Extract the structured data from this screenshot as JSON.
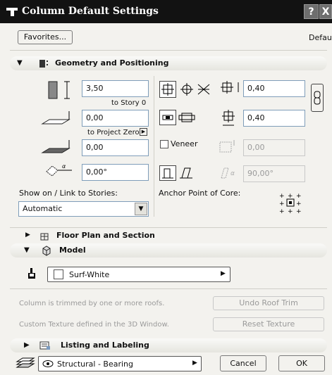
{
  "window": {
    "title": "Column Default Settings",
    "help": "?",
    "close": "X"
  },
  "toolbar": {
    "favorites": "Favorites...",
    "default": "Default"
  },
  "geometry": {
    "header": "Geometry and Positioning",
    "height_value": "3,50",
    "height_ref": "to Story 0",
    "bottom_value": "0,00",
    "bottom_ref": "to Project Zero",
    "offset_value": "0,00",
    "angle_value": "0,00°",
    "show_on_label": "Show on / Link to Stories:",
    "show_on_value": "Automatic",
    "width_value": "0,40",
    "depth_value": "0,40",
    "veneer_label": "Veneer",
    "veneer_value": "0,00",
    "slant_value": "90,00°",
    "anchor_label": "Anchor Point of Core:"
  },
  "floor_plan": {
    "header": "Floor Plan and Section"
  },
  "model": {
    "header": "Model",
    "surface": "Surf-White",
    "roof_msg": "Column is trimmed by one or more roofs.",
    "undo_roof": "Undo Roof Trim",
    "texture_msg": "Custom Texture defined in the 3D Window.",
    "reset_texture": "Reset Texture"
  },
  "listing": {
    "header": "Listing and Labeling"
  },
  "footer": {
    "layer": "Structural - Bearing",
    "cancel": "Cancel",
    "ok": "OK"
  },
  "icons": [
    "app-icon",
    "geometry-icon",
    "height-icon",
    "bottom-icon",
    "offset-icon",
    "angle-icon",
    "anchor-icon",
    "rect-icon",
    "circle-icon",
    "link-icon",
    "width-icon",
    "depth-icon",
    "veneer-icon",
    "vertical-icon",
    "slant-icon",
    "floorplan-icon",
    "model-icon",
    "brush-icon",
    "listing-icon",
    "layers-icon",
    "eye-icon"
  ]
}
